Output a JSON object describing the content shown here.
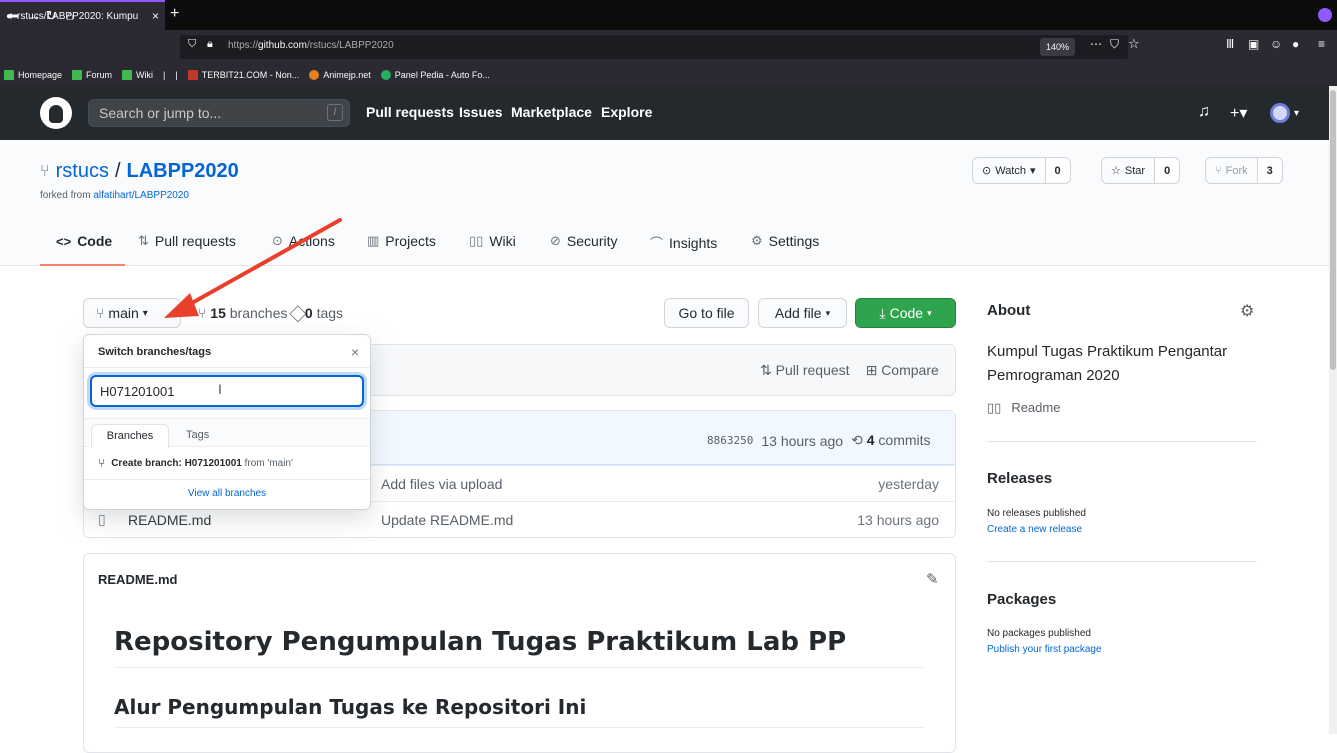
{
  "browser": {
    "tab_title": "rstucs/LABPP2020: Kumpu",
    "tab_close": "×",
    "new_tab": "+",
    "url_prefix": "https://",
    "url_host": "github.com",
    "url_path": "/rstucs/LABPP2020",
    "zoom": "140%",
    "bookmarks": [
      {
        "label": "Homepage"
      },
      {
        "label": "Forum"
      },
      {
        "label": "Wiki"
      },
      {
        "label": "TERBIT21.COM - Non..."
      },
      {
        "label": "Animejp.net"
      },
      {
        "label": "Panel Pedia - Auto Fo..."
      }
    ]
  },
  "header": {
    "search_placeholder": "Search or jump to...",
    "search_key": "/",
    "nav": [
      "Pull requests",
      "Issues",
      "Marketplace",
      "Explore"
    ]
  },
  "repo": {
    "owner": "rstucs",
    "sep": "/",
    "name": "LABPP2020",
    "forked_prefix": "forked from ",
    "forked_from": "alfatihart/LABPP2020",
    "watch_label": "Watch",
    "watch_count": "0",
    "star_label": "Star",
    "star_count": "0",
    "fork_label": "Fork",
    "fork_count": "3",
    "tabs": [
      {
        "label": "Code",
        "icon": "<>"
      },
      {
        "label": "Pull requests",
        "icon": "⇅"
      },
      {
        "label": "Actions",
        "icon": "⊙"
      },
      {
        "label": "Projects",
        "icon": "▥"
      },
      {
        "label": "Wiki",
        "icon": "▯▯"
      },
      {
        "label": "Security",
        "icon": "⊘"
      },
      {
        "label": "Insights",
        "icon": "⌒"
      },
      {
        "label": "Settings",
        "icon": "⚙"
      }
    ]
  },
  "toolbar": {
    "branch": "main",
    "branches_count": "15",
    "branches_label": " branches",
    "tags_count": "0",
    "tags_label": " tags",
    "goto_file": "Go to file",
    "add_file": "Add file",
    "code": "Code"
  },
  "compare": {
    "pull_request": "Pull request",
    "compare": "Compare"
  },
  "commit": {
    "sha": "8863250",
    "age": "13 hours ago",
    "commits_count": "4",
    "commits_label": " commits"
  },
  "files": [
    {
      "name": "",
      "message": "Add files via upload",
      "age": "yesterday"
    },
    {
      "name": "README.md",
      "message": "Update README.md",
      "age": "13 hours ago"
    }
  ],
  "readme": {
    "filename": "README.md",
    "h1": "Repository Pengumpulan Tugas Praktikum Lab PP",
    "h2": "Alur Pengumpulan Tugas ke Repositori Ini"
  },
  "sidebar": {
    "about_title": "About",
    "about_desc": "Kumpul Tugas Praktikum Pengantar Pemrograman 2020",
    "readme_label": "Readme",
    "releases_title": "Releases",
    "releases_none": "No releases published",
    "releases_link": "Create a new release",
    "packages_title": "Packages",
    "packages_none": "No packages published",
    "packages_link": "Publish your first package"
  },
  "dropdown": {
    "title": "Switch branches/tags",
    "close": "×",
    "input_value": "H071201001",
    "tab_branches": "Branches",
    "tab_tags": "Tags",
    "create_prefix": "Create branch: ",
    "create_name": "H071201001",
    "create_from": " from 'main'",
    "view_all": "View all branches"
  },
  "colors": {
    "arrow": "#e8402a",
    "accent": "#0366d6",
    "code_button": "#2ea44f",
    "header_bg": "#24292e"
  }
}
